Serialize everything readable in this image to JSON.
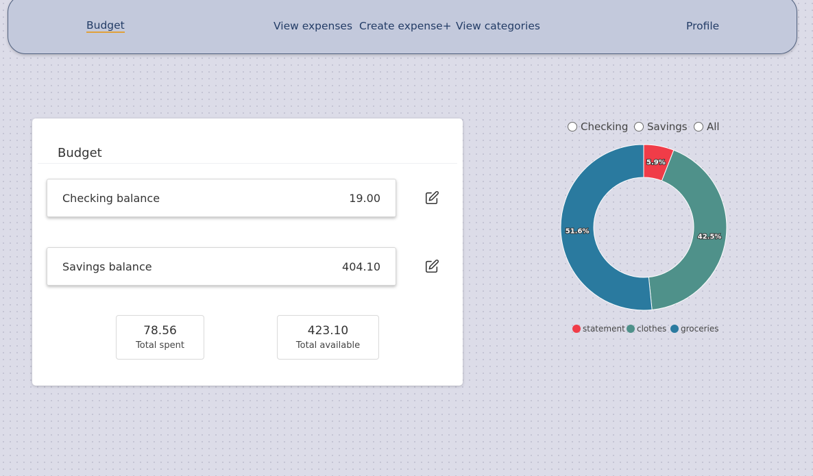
{
  "nav": {
    "brand": "Budget",
    "view_expenses": "View expenses",
    "create_expense": "Create expense+",
    "view_categories": "View categories",
    "profile": "Profile"
  },
  "budget_card": {
    "title": "Budget",
    "checking": {
      "label": "Checking balance",
      "value": "19.00"
    },
    "savings": {
      "label": "Savings balance",
      "value": "404.10"
    },
    "total_spent": {
      "value": "78.56",
      "label": "Total spent"
    },
    "total_available": {
      "value": "423.10",
      "label": "Total available"
    },
    "edit_icon": "pencil-square-icon"
  },
  "account_filter": {
    "options": [
      "Checking",
      "Savings",
      "All"
    ],
    "selected": null
  },
  "chart_data": {
    "type": "pie",
    "variant": "doughnut",
    "categories": [
      "statement",
      "clothes",
      "groceries"
    ],
    "values": [
      5.9,
      42.5,
      51.6
    ],
    "value_labels": [
      "5.9%",
      "42.5%",
      "51.6%"
    ],
    "colors": [
      "#f03c48",
      "#4f918a",
      "#2a7a9f"
    ],
    "legend_position": "bottom"
  },
  "colors": {
    "nav_background": "#c3c9dc",
    "nav_text": "#233c66",
    "active_underline": "#e0a13a",
    "page_background": "#dcdce8"
  }
}
